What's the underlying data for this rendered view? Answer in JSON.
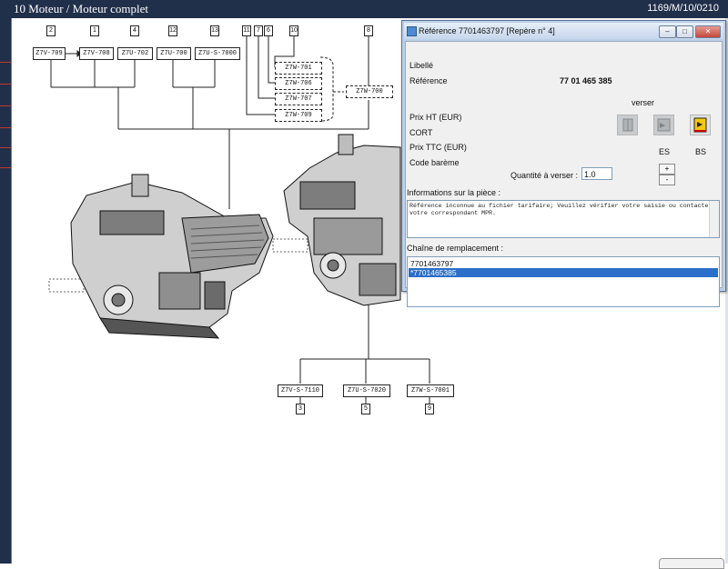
{
  "header": {
    "title": "10 Moteur / Moteur complet",
    "code": "1169/M/10/0210"
  },
  "diagram": {
    "top_parts": [
      "Z7V-709",
      "Z7V-708",
      "Z7U-702",
      "Z7U-700",
      "Z7U-S-7000"
    ],
    "top_numbers": [
      "2",
      "1",
      "4",
      "12",
      "13"
    ],
    "dash_numbers": [
      "11",
      "7",
      "6",
      "10",
      "8"
    ],
    "dash_parts": [
      "Z7W-701",
      "Z7W-706",
      "Z7W-707",
      "Z7W-709"
    ],
    "right_part": "Z7W-700",
    "bottom_parts": [
      "Z7V-S-7110",
      "Z7U-S-7020",
      "Z7W-S-7001"
    ],
    "bottom_numbers": [
      "3",
      "5",
      "9"
    ]
  },
  "dialog": {
    "title": "Référence 7701463797 [Repère n° 4]",
    "labels": {
      "libelle": "Libellé",
      "reference": "Référence",
      "prix_ht": "Prix HT (EUR)",
      "cort": "CORT",
      "prix_ttc": "Prix TTC (EUR)",
      "code_bareme": "Code barème",
      "verser": "verser",
      "quantite": "Quantité à verser :",
      "es": "ES",
      "bs": "BS",
      "informations": "Informations sur la pièce :",
      "chaine": "Chaîne de remplacement :"
    },
    "reference_value": "77 01 465 385",
    "quantite_value": "1.0",
    "spin_up": "+",
    "spin_down": "-",
    "info_text": "Référence inconnue au fichier tarifaire; Veuillez vérifier votre saisie ou contacter votre correspondant MPR.",
    "replacement_chain": [
      "7701463797",
      "*7701465385"
    ],
    "selected_index": 1,
    "window_buttons": {
      "minimize": "–",
      "maximize": "□",
      "close": "✕"
    }
  },
  "colors": {
    "header_bg": "#202f4a",
    "dialog_frame": "#bcd0e8",
    "selection": "#2a6fc9",
    "bs_icon": "#f2c811"
  }
}
